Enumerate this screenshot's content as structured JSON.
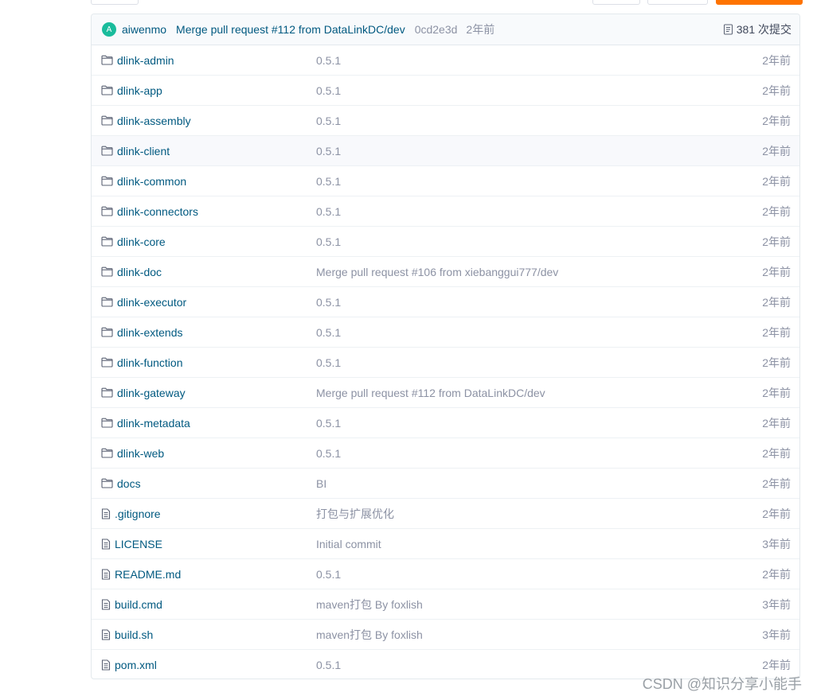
{
  "commit": {
    "avatar_initial": "A",
    "author": "aiwenmo",
    "message": "Merge pull request #112 from DataLinkDC/dev",
    "sha": "0cd2e3d",
    "time": "2年前",
    "count_label": "381 次提交"
  },
  "colors": {
    "avatar": "#1abc9c",
    "link": "#005980",
    "muted": "#8c92a4",
    "accent": "#fe7300"
  },
  "files": [
    {
      "type": "folder",
      "icon": "folder-icon",
      "name": "dlink-admin",
      "message": "0.5.1",
      "time": "2年前"
    },
    {
      "type": "folder",
      "icon": "folder-icon",
      "name": "dlink-app",
      "message": "0.5.1",
      "time": "2年前"
    },
    {
      "type": "folder",
      "icon": "folder-icon",
      "name": "dlink-assembly",
      "message": "0.5.1",
      "time": "2年前"
    },
    {
      "type": "folder",
      "icon": "folder-icon",
      "name": "dlink-client",
      "message": "0.5.1",
      "time": "2年前",
      "hover": true
    },
    {
      "type": "folder",
      "icon": "folder-icon",
      "name": "dlink-common",
      "message": "0.5.1",
      "time": "2年前"
    },
    {
      "type": "folder",
      "icon": "folder-icon",
      "name": "dlink-connectors",
      "message": "0.5.1",
      "time": "2年前"
    },
    {
      "type": "folder",
      "icon": "folder-icon",
      "name": "dlink-core",
      "message": "0.5.1",
      "time": "2年前"
    },
    {
      "type": "folder",
      "icon": "folder-icon",
      "name": "dlink-doc",
      "message": "Merge pull request #106 from xiebanggui777/dev",
      "time": "2年前"
    },
    {
      "type": "folder",
      "icon": "folder-icon",
      "name": "dlink-executor",
      "message": "0.5.1",
      "time": "2年前"
    },
    {
      "type": "folder",
      "icon": "folder-icon",
      "name": "dlink-extends",
      "message": "0.5.1",
      "time": "2年前"
    },
    {
      "type": "folder",
      "icon": "folder-icon",
      "name": "dlink-function",
      "message": "0.5.1",
      "time": "2年前"
    },
    {
      "type": "folder",
      "icon": "folder-icon",
      "name": "dlink-gateway",
      "message": "Merge pull request #112 from DataLinkDC/dev",
      "time": "2年前"
    },
    {
      "type": "folder",
      "icon": "folder-icon",
      "name": "dlink-metadata",
      "message": "0.5.1",
      "time": "2年前"
    },
    {
      "type": "folder",
      "icon": "folder-icon",
      "name": "dlink-web",
      "message": "0.5.1",
      "time": "2年前"
    },
    {
      "type": "folder",
      "icon": "folder-icon",
      "name": "docs",
      "message": "BI",
      "time": "2年前"
    },
    {
      "type": "file",
      "icon": "file-icon",
      "name": ".gitignore",
      "message": "打包与扩展优化",
      "time": "2年前"
    },
    {
      "type": "file",
      "icon": "file-icon",
      "name": "LICENSE",
      "message": "Initial commit",
      "time": "3年前"
    },
    {
      "type": "file",
      "icon": "file-icon",
      "name": "README.md",
      "message": "0.5.1",
      "time": "2年前"
    },
    {
      "type": "file",
      "icon": "file-icon",
      "name": "build.cmd",
      "message": "maven打包 By foxlish",
      "time": "3年前"
    },
    {
      "type": "file",
      "icon": "file-icon",
      "name": "build.sh",
      "message": "maven打包 By foxlish",
      "time": "3年前"
    },
    {
      "type": "file",
      "icon": "file-icon",
      "name": "pom.xml",
      "message": "0.5.1",
      "time": "2年前"
    }
  ],
  "watermark": "CSDN @知识分享小能手"
}
